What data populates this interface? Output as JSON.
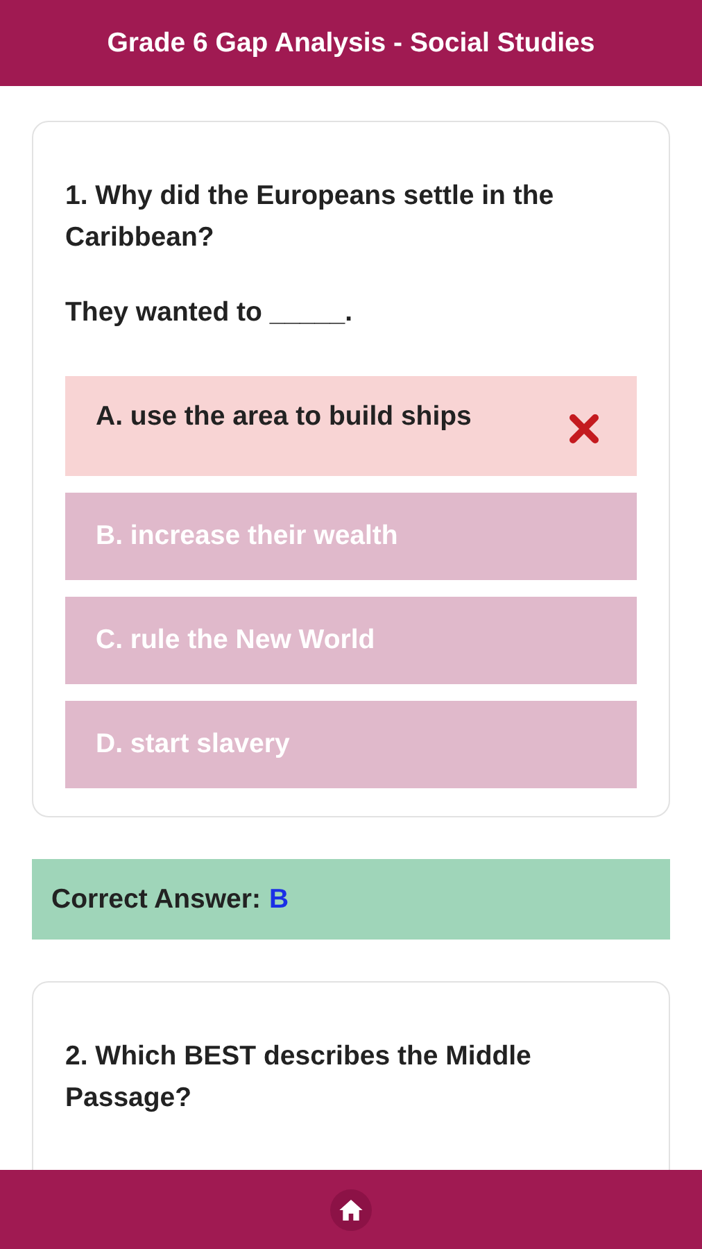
{
  "header": {
    "title": "Grade 6 Gap Analysis - Social Studies"
  },
  "questions": [
    {
      "question": "1. Why did the Europeans settle in the Caribbean?",
      "prompt": "They wanted to _____.",
      "options": [
        {
          "text": "A. use the area to build ships",
          "selected": true
        },
        {
          "text": "B. increase their wealth",
          "selected": false
        },
        {
          "text": "C. rule the New World",
          "selected": false
        },
        {
          "text": "D. start slavery",
          "selected": false
        }
      ],
      "answer": {
        "label": "Correct Answer:",
        "value": "B"
      }
    },
    {
      "question": "2. Which BEST describes the Middle Passage?"
    }
  ]
}
